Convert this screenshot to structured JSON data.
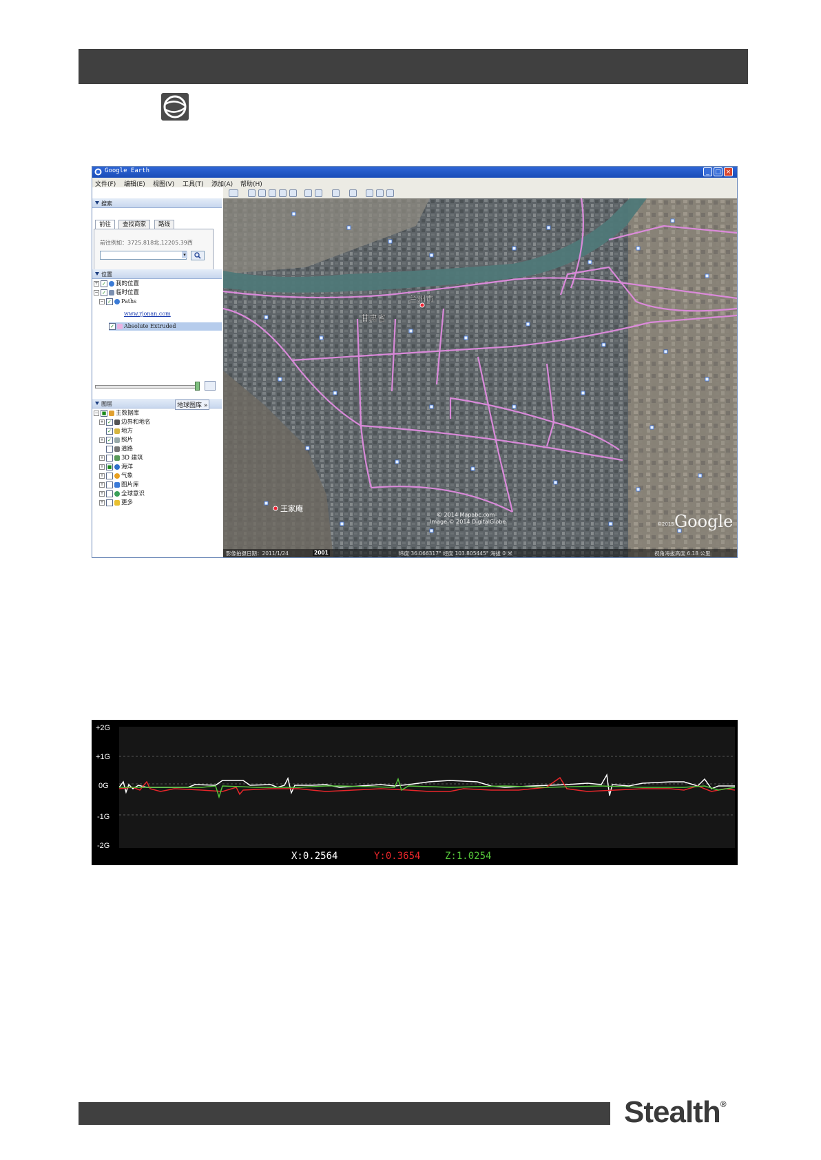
{
  "app": {
    "title": "Google Earth"
  },
  "menu": [
    "文件(F)",
    "编辑(E)",
    "视图(V)",
    "工具(T)",
    "添加(A)",
    "帮助(H)"
  ],
  "search_panel": {
    "header": "搜索",
    "tabs": [
      "前往",
      "查找商家",
      "路线"
    ],
    "hint": "前往例如：3725.818北,12205.39西",
    "input_value": ""
  },
  "places_panel": {
    "header": "位置",
    "items": [
      "我的位置",
      "临时位置",
      "Paths",
      "www.rjonan.com",
      "Absolute Extruded"
    ]
  },
  "layers_panel": {
    "header": "图层",
    "gallery_button": "地球图库 »",
    "items": [
      "主数据库",
      "边界和地名",
      "地方",
      "照片",
      "道路",
      "3D 建筑",
      "海洋",
      "气象",
      "图片库",
      "全球意识",
      "更多"
    ]
  },
  "map": {
    "labels": {
      "city": "兰州市",
      "province": "甘肃省",
      "town": "王家庵"
    },
    "copyright": [
      "© 2014 Mapabc.com",
      "Image © 2014 DigitalGlobe"
    ],
    "watermark": "Google",
    "year_badge": "©2015",
    "status": {
      "date": "影像拍摄日期：2011/1/24",
      "year": "2001",
      "coords": "纬度 36.066317° 经度 103.805445° 海拔 0 米",
      "eye_alt": "视角海拔高度 6.18 公里"
    }
  },
  "accelerometer": {
    "y_labels": [
      "+2G",
      "+1G",
      "0G",
      "-1G",
      "-2G"
    ],
    "readout": {
      "x": "X:0.2564",
      "y": "Y:0.3654",
      "z": "Z:1.0254"
    },
    "colors": {
      "x": "#ffffff",
      "y": "#e8262a",
      "z": "#55c43a"
    }
  },
  "footer": {
    "brand": "Stealth",
    "mark": "®"
  }
}
